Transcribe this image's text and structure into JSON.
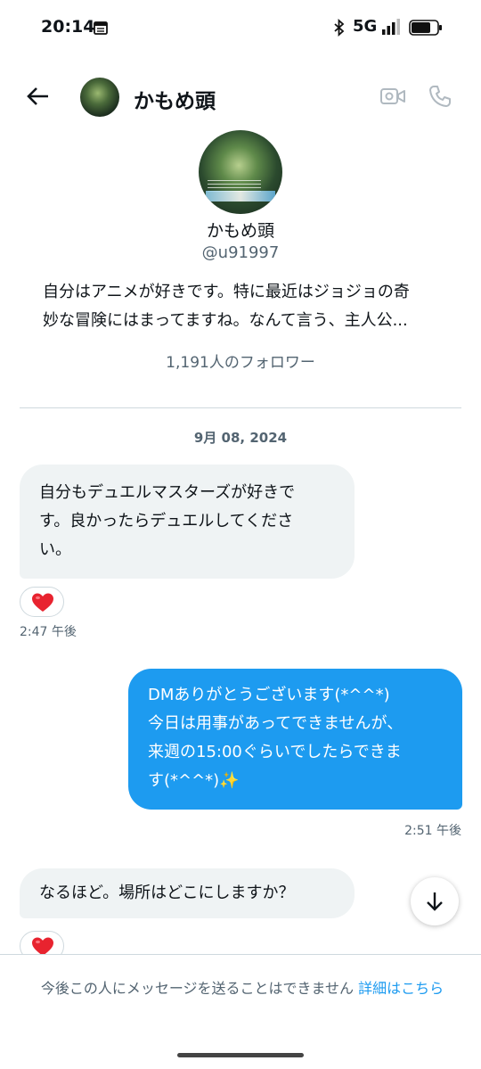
{
  "status_bar": {
    "time": "20:14",
    "network": "5G",
    "icons": [
      "calendar-icon",
      "bluetooth-icon",
      "signal-icon",
      "battery-icon"
    ]
  },
  "header": {
    "title": "かもめ頭",
    "icons": [
      "back-arrow-icon",
      "video-call-icon",
      "phone-call-icon"
    ]
  },
  "profile": {
    "name": "かもめ頭",
    "handle": "@u91997",
    "bio": [
      "自分はアニメが好きです。特に最近はジョジョの奇",
      "妙な冒険にはまってますね。なんて言う、主人公..."
    ],
    "followers": "1,191人のフォロワー"
  },
  "date_separator": "9月 08, 2024",
  "messages": [
    {
      "direction": "in",
      "lines": [
        "自分もデュエルマスターズが好きで",
        "す。良かったらデュエルしてくださ",
        "い。"
      ],
      "reaction": "heart",
      "time": "2:47 午後"
    },
    {
      "direction": "out",
      "lines": [
        "DMありがとうございます(*^^*)",
        "今日は用事があってできませんが、",
        "来週の15:00ぐらいでしたらできま",
        "す(*^^*)✨"
      ],
      "time": "2:51 午後"
    },
    {
      "direction": "in",
      "lines": [
        "なるほど。場所はどこにしますか？"
      ],
      "reaction": "heart"
    }
  ],
  "footer": {
    "notice": "今後この人にメッセージを送ることはできません ",
    "link": "詳細はこちら"
  },
  "colors": {
    "accent": "#1d9bf0",
    "incoming_bubble": "#eff3f4",
    "secondary_text": "#536471",
    "heart": "#f4212e"
  }
}
